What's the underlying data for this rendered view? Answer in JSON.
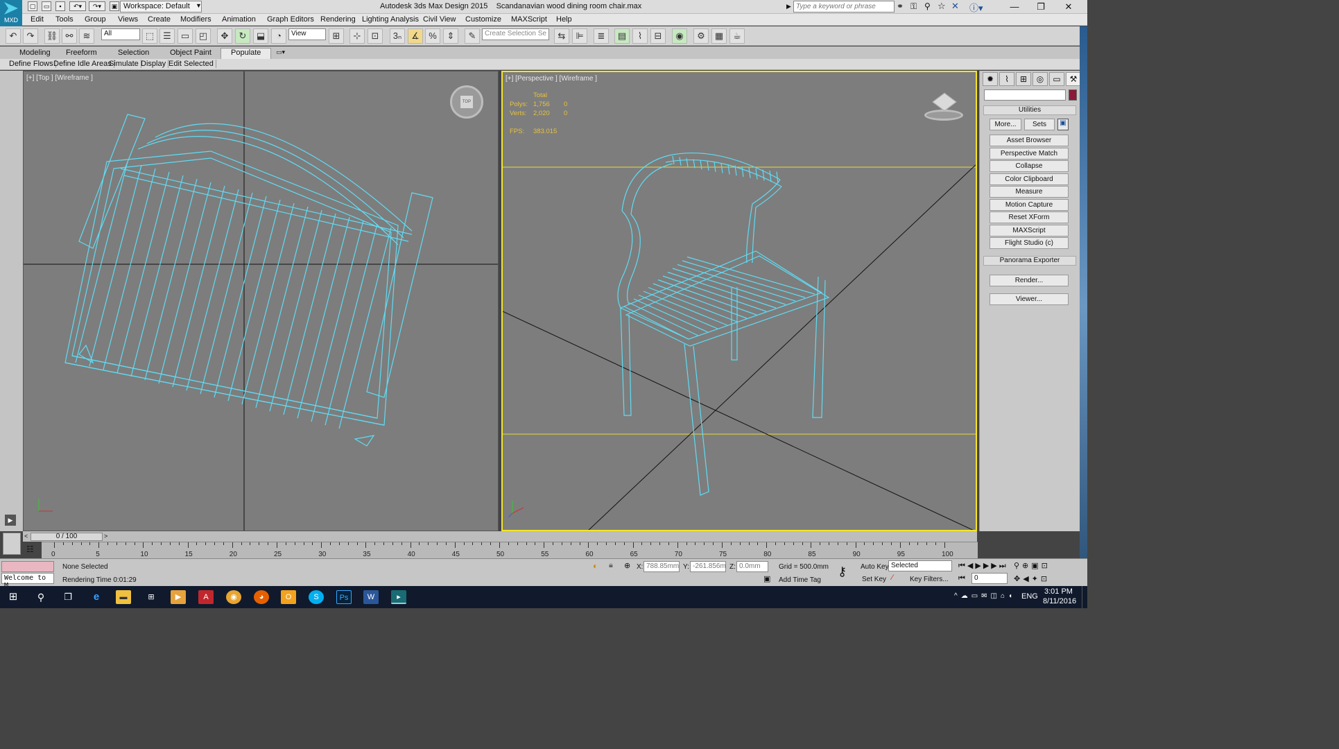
{
  "app": {
    "title": "Autodesk 3ds Max Design 2015",
    "file": "Scandanavian wood dining room chair.max",
    "logo_text": "MXD",
    "workspace": "Workspace: Default",
    "search_placeholder": "Type a keyword or phrase"
  },
  "menu": [
    "Edit",
    "Tools",
    "Group",
    "Views",
    "Create",
    "Modifiers",
    "Animation",
    "Graph Editors",
    "Rendering",
    "Lighting Analysis",
    "Civil View",
    "Customize",
    "MAXScript",
    "Help"
  ],
  "toolbar": {
    "selection_filter": "All",
    "ref_coord": "View",
    "snap_value": "3",
    "selection_set_placeholder": "Create Selection Se"
  },
  "ribbon_tabs": [
    "Modeling",
    "Freeform",
    "Selection",
    "Object Paint",
    "Populate"
  ],
  "ribbon_active": "Populate",
  "sub_tabs": [
    "Define Flows",
    "Define Idle Areas",
    "Simulate",
    "Display",
    "Edit Selected"
  ],
  "viewports": {
    "top": {
      "label": "[+] [Top ] [Wireframe ]",
      "cube": "TOP"
    },
    "perspective": {
      "label": "[+] [Perspective ] [Wireframe ]",
      "stats_header": "Total",
      "polys_label": "Polys:",
      "polys_total": "1,756",
      "polys_sel": "0",
      "verts_label": "Verts:",
      "verts_total": "2,020",
      "verts_sel": "0",
      "fps_label": "FPS:",
      "fps": "383.015"
    }
  },
  "command_panel": {
    "utilities_title": "Utilities",
    "more": "More...",
    "sets": "Sets",
    "buttons": [
      "Asset Browser",
      "Perspective Match",
      "Collapse",
      "Color Clipboard",
      "Measure",
      "Motion Capture",
      "Reset XForm",
      "MAXScript",
      "Flight Studio (c)"
    ],
    "panorama_title": "Panorama Exporter",
    "render": "Render...",
    "viewer": "Viewer...",
    "swatch_color": "#8b1a3a"
  },
  "timeline": {
    "frame": "0 / 100",
    "ticks": [
      "0",
      "5",
      "10",
      "15",
      "20",
      "25",
      "30",
      "35",
      "40",
      "45",
      "50",
      "55",
      "60",
      "65",
      "70",
      "75",
      "80",
      "85",
      "90",
      "95",
      "100"
    ]
  },
  "status": {
    "maxscript": "Welcome to M",
    "selection": "None Selected",
    "render_time": "Rendering Time  0:01:29",
    "x_label": "X:",
    "x": "788.85mm",
    "y_label": "Y:",
    "y": "-261.856m",
    "z_label": "Z:",
    "z": "0.0mm",
    "grid": "Grid = 500.0mm",
    "add_time_tag": "Add Time Tag",
    "auto_key": "Auto Key",
    "set_key": "Set Key",
    "selected": "Selected",
    "key_filters": "Key Filters...",
    "frame_field": "0"
  },
  "taskbar": {
    "lang": "ENG",
    "time": "3:01 PM",
    "date": "8/11/2016"
  },
  "colors": {
    "wire": "#5fdcf4",
    "viewport_bg": "#7d7d7d",
    "active_border": "#f5e524",
    "stats": "#e8c23c"
  }
}
